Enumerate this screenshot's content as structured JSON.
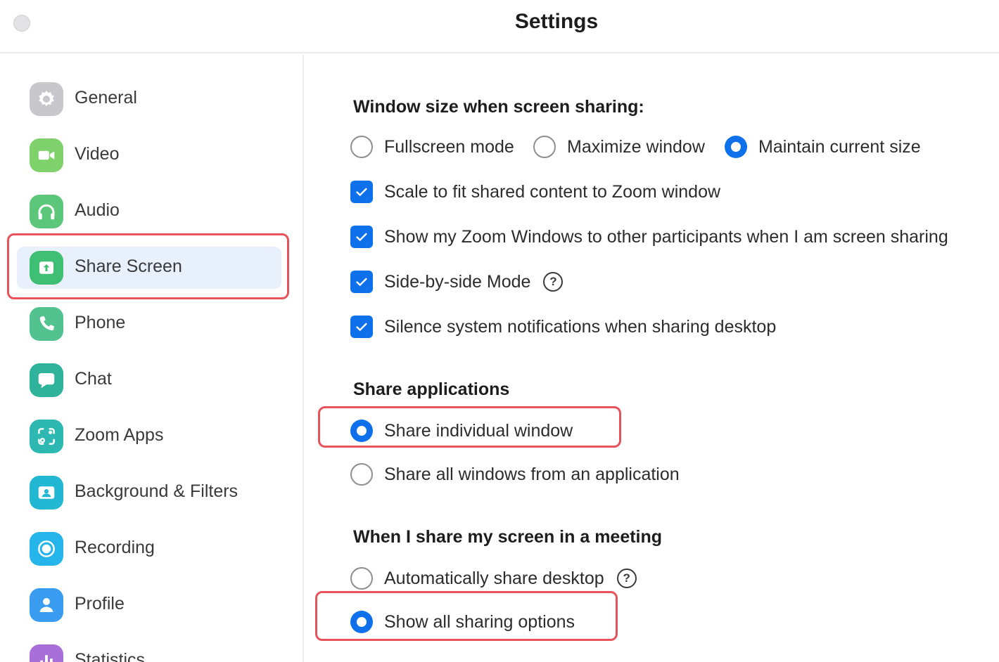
{
  "window": {
    "title": "Settings"
  },
  "sidebar": {
    "items": [
      {
        "label": "General",
        "icon": "gear-icon",
        "color": "#c7c7cc"
      },
      {
        "label": "Video",
        "icon": "video-camera-icon",
        "color": "#7fd16b"
      },
      {
        "label": "Audio",
        "icon": "headphones-icon",
        "color": "#5cc77a"
      },
      {
        "label": "Share Screen",
        "icon": "share-screen-icon",
        "color": "#3fbf74",
        "selected": true
      },
      {
        "label": "Phone",
        "icon": "phone-icon",
        "color": "#52c28f"
      },
      {
        "label": "Chat",
        "icon": "chat-bubble-icon",
        "color": "#2fb39b"
      },
      {
        "label": "Zoom Apps",
        "icon": "zoom-apps-icon",
        "color": "#2db8b1"
      },
      {
        "label": "Background & Filters",
        "icon": "background-image-icon",
        "color": "#22b8d4"
      },
      {
        "label": "Recording",
        "icon": "record-icon",
        "color": "#25b5ea"
      },
      {
        "label": "Profile",
        "icon": "profile-person-icon",
        "color": "#3a9cf0"
      },
      {
        "label": "Statistics",
        "icon": "statistics-bar-icon",
        "color": "#a86fd9"
      }
    ]
  },
  "window_size": {
    "heading": "Window size when screen sharing:",
    "options": [
      {
        "label": "Fullscreen mode",
        "selected": false
      },
      {
        "label": "Maximize window",
        "selected": false
      },
      {
        "label": "Maintain current size",
        "selected": true
      }
    ],
    "checkboxes": [
      {
        "label": "Scale to fit shared content to Zoom window",
        "checked": true
      },
      {
        "label": "Show my Zoom Windows to other participants when I am screen sharing",
        "checked": true
      },
      {
        "label": "Side-by-side Mode",
        "checked": true,
        "help": "?"
      },
      {
        "label": "Silence system notifications when sharing desktop",
        "checked": true
      }
    ]
  },
  "share_applications": {
    "heading": "Share applications",
    "options": [
      {
        "label": "Share individual window",
        "selected": true
      },
      {
        "label": "Share all windows from an application",
        "selected": false
      }
    ]
  },
  "meeting_share": {
    "heading": "When I share my screen in a meeting",
    "options": [
      {
        "label": "Automatically share desktop",
        "selected": false,
        "help": "?"
      },
      {
        "label": "Show all sharing options",
        "selected": true
      }
    ]
  },
  "colors": {
    "accent": "#0e71eb",
    "highlight": "#e8535a",
    "selected_bg": "#e8f0fc"
  }
}
